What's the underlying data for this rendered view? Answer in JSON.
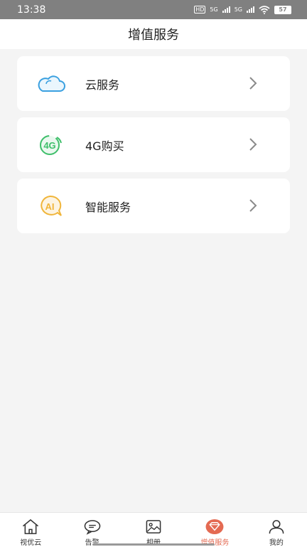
{
  "status": {
    "time": "13:38",
    "hd": "HD",
    "net1": "5G",
    "net2": "5G",
    "battery": "57"
  },
  "header": {
    "title": "增值服务"
  },
  "services": [
    {
      "label": "云服务",
      "icon": "cloud-icon"
    },
    {
      "label": "4G购买",
      "icon": "4g-icon"
    },
    {
      "label": "智能服务",
      "icon": "ai-icon"
    }
  ],
  "tabs": [
    {
      "label": "视优云",
      "icon": "home-icon"
    },
    {
      "label": "告警",
      "icon": "chat-bubble-icon"
    },
    {
      "label": "相册",
      "icon": "image-icon"
    },
    {
      "label": "增值服务",
      "icon": "diamond-heart-icon",
      "active": true
    },
    {
      "label": "我的",
      "icon": "person-icon"
    }
  ],
  "colors": {
    "accent": "#e46a52",
    "cloud": "#3aa0e0",
    "fourg": "#3fbf6b",
    "ai": "#f0b53a"
  }
}
